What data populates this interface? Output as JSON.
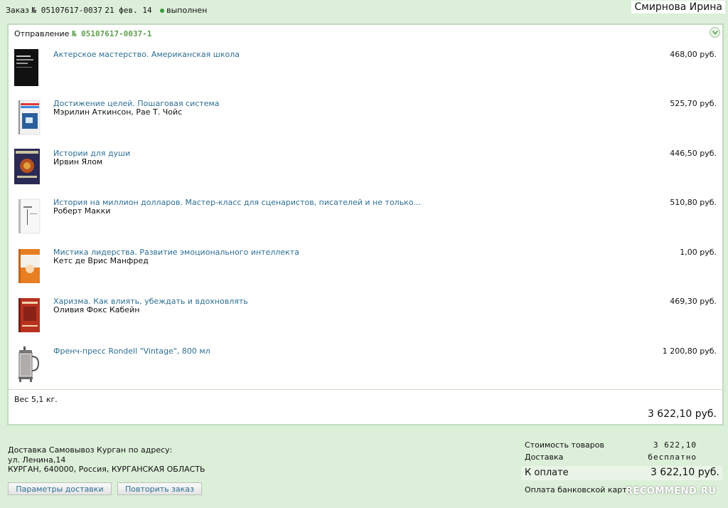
{
  "order": {
    "label": "Заказ",
    "number": "№ 05107617-0037",
    "date": "21 фев. 14",
    "status": "выполнен"
  },
  "user": {
    "name": "Смирнова Ирина"
  },
  "shipment": {
    "label": "Отправление",
    "number": "№ 05107617-0037-1",
    "items": [
      {
        "title": "Актерское мастерство. Американская школа",
        "author": "",
        "price": "468,00 руб.",
        "cover": "book-cover-black"
      },
      {
        "title": "Достижение целей. Пошаговая система",
        "author": "Мэрилин Аткинсон, Рае Т. Чойс",
        "price": "525,70 руб.",
        "cover": "book-cover-blue"
      },
      {
        "title": "Истории для души",
        "author": "Ирвин Ялом",
        "price": "446,50 руб.",
        "cover": "book-cover-ornate"
      },
      {
        "title": "История на миллион долларов. Мастер-класс для сценаристов, писателей и не только...",
        "author": "Роберт Макки",
        "price": "510,80 руб.",
        "cover": "book-cover-white"
      },
      {
        "title": "Мистика лидерства. Развитие эмоционального интеллекта",
        "author": "Кетс де Врис Манфред",
        "price": "1,00 руб.",
        "cover": "book-cover-orange"
      },
      {
        "title": "Харизма. Как влиять, убеждать и вдохновлять",
        "author": "Оливия Фокс Кабейн",
        "price": "469,30 руб.",
        "cover": "book-cover-red"
      },
      {
        "title": "Френч-пресс Rondell \"Vintage\", 800 мл",
        "author": "",
        "price": "1 200,80 руб.",
        "cover": "french-press-image"
      }
    ],
    "weight": "Вес 5,1 кг.",
    "total": "3 622,10 руб."
  },
  "delivery": {
    "line1": "Доставка Самовывоз Курган по адресу:",
    "line2": "ул. Ленина,14",
    "line3": "КУРГАН, 640000, Россия, КУРГАНСКАЯ ОБЛАСТЬ",
    "params_button": "Параметры доставки",
    "repeat_button": "Повторить заказ"
  },
  "summary": {
    "goods_label": "Стоимость товаров",
    "goods_value": "3 622,10",
    "delivery_label": "Доставка",
    "delivery_value": "бесплатно",
    "pay_label": "К оплате",
    "pay_value": "3 622,10 руб.",
    "payment_method": "Оплата банковской карто"
  },
  "watermark": "RECOMMEND.RU",
  "colors": {
    "link": "#2e6f95",
    "accent": "#5f9f4f",
    "background": "#dcefd9",
    "status": "#3a9a3a"
  }
}
